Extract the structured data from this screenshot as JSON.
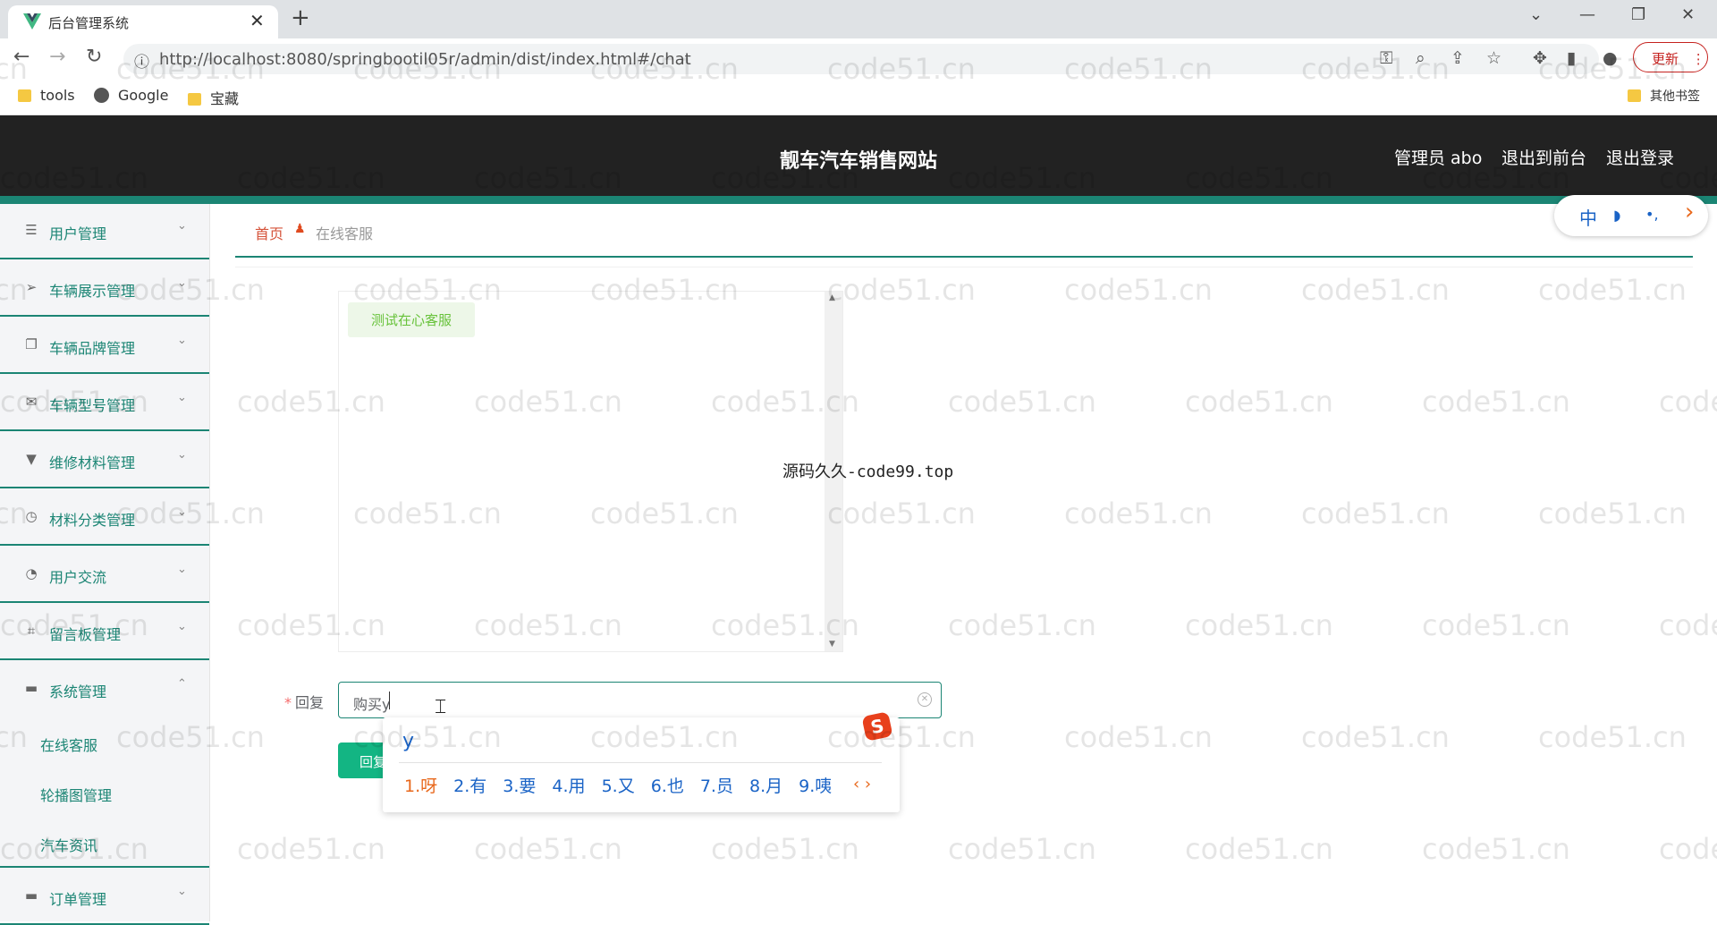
{
  "browser": {
    "tab_title": "后台管理系统",
    "tab_close": "✕",
    "new_tab": "+",
    "url": "http://localhost:8080/springbootil05r/admin/dist/index.html#/chat",
    "update_label": "更新",
    "bookmarks": [
      "tools",
      "Google",
      "宝藏"
    ],
    "other_bookmarks": "其他书签"
  },
  "header": {
    "site_title": "靓车汽车销售网站",
    "user_label": "管理员 abo",
    "to_front": "退出到前台",
    "logout": "退出登录"
  },
  "sidebar": {
    "items": [
      {
        "label": "用户管理",
        "icon": "list-icon"
      },
      {
        "label": "车辆展示管理",
        "icon": "send-icon"
      },
      {
        "label": "车辆品牌管理",
        "icon": "copy-icon"
      },
      {
        "label": "车辆型号管理",
        "icon": "mail-icon"
      },
      {
        "label": "维修材料管理",
        "icon": "bookmark-icon"
      },
      {
        "label": "材料分类管理",
        "icon": "clock-icon"
      },
      {
        "label": "用户交流",
        "icon": "gauge-icon"
      },
      {
        "label": "留言板管理",
        "icon": "crop-icon"
      },
      {
        "label": "系统管理",
        "icon": "chat-icon"
      },
      {
        "label": "订单管理",
        "icon": "chat-icon"
      }
    ],
    "sub_items": [
      "在线客服",
      "轮播图管理",
      "汽车资讯"
    ]
  },
  "breadcrumb": {
    "home": "首页",
    "current": "在线客服"
  },
  "lang_switch": {
    "items": [
      "中",
      "◗",
      "•,",
      "›"
    ]
  },
  "chat": {
    "messages": [
      "测试在心客服"
    ],
    "overlay_text": "源码久久-code99.top"
  },
  "reply": {
    "label": "回复",
    "value": "购买y",
    "button": "回复"
  },
  "ime": {
    "composition": "y",
    "candidates": [
      "1.呀",
      "2.有",
      "3.要",
      "4.用",
      "5.又",
      "6.也",
      "7.员",
      "8.月",
      "9.咦"
    ],
    "logo": "S"
  },
  "watermark": "code51.cn"
}
